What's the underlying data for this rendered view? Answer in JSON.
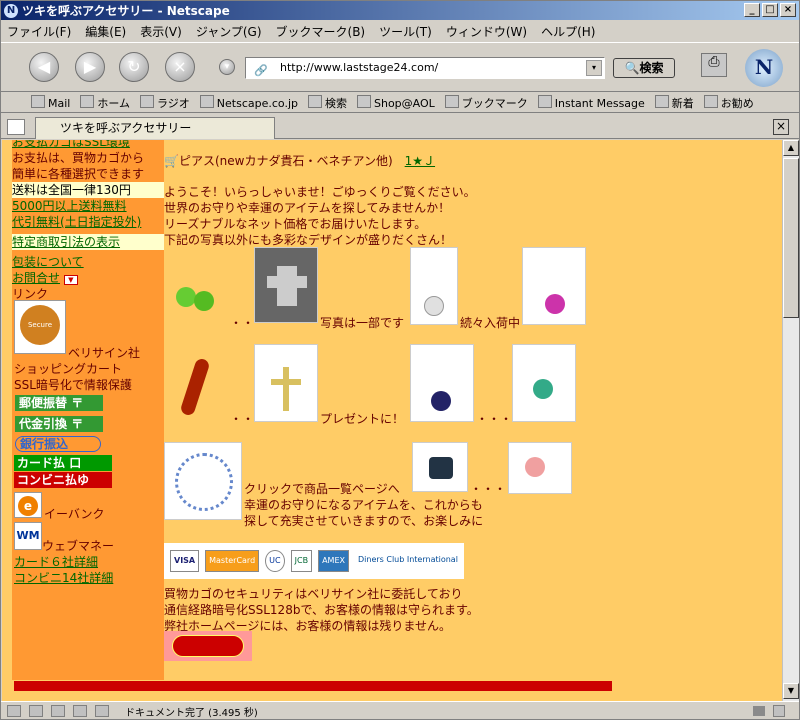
{
  "window": {
    "title": "ツキを呼ぶアクセサリー - Netscape"
  },
  "menu": [
    "ファイル(F)",
    "編集(E)",
    "表示(V)",
    "ジャンプ(G)",
    "ブックマーク(B)",
    "ツール(T)",
    "ウィンドウ(W)",
    "ヘルプ(H)"
  ],
  "nav": {
    "url": "http://www.laststage24.com/",
    "search_label": "検索"
  },
  "personal_bar": [
    "Mail",
    "ホーム",
    "ラジオ",
    "Netscape.co.jp",
    "検索",
    "Shop@AOL",
    "ブックマーク",
    "Instant Message",
    "新着",
    "お勧め"
  ],
  "tab": {
    "title": "ツキを呼ぶアクセサリー"
  },
  "sidebar": {
    "top_cut": "お支払カゴはSSL環境",
    "pay1": "お支払は、買物カゴから",
    "pay2": "簡単に各種選択できます",
    "shipping": "送料は全国一律130円",
    "free_ship": "5000円以上送料無料",
    "cod_free": "代引無料(土日指定投外)",
    "law": "特定商取引法の表示",
    "wrap": "包装について",
    "contact": "お問合せ",
    "links": "リンク",
    "verisign_text": "ベリサイン社",
    "cart1": "ショッピングカート",
    "cart2": "SSL暗号化で情報保護",
    "postal": "郵便振替",
    "cod": "代金引換",
    "bank": "銀行振込",
    "card": "カード払",
    "convenience": "コンビニ払",
    "ebank": "イーバンク",
    "webmoney": "ウェブマネー",
    "card_detail": "カード６社詳細",
    "conv_detail": "コンビニ14社詳細"
  },
  "main": {
    "top_cut": "ピアス(newカナダ貴石・ベネチアン他)",
    "top_link": "1★Ｊ",
    "welcome": "ようこそ！いらっしゃいませ！ごゆっくりご覧ください。",
    "line2": "世界のお守りや幸運のアイテムを探してみませんか！",
    "line3": "リーズナブルなネット価格でお届けいたします。",
    "line4": "下記の写真以外にも多彩なデザインが盛りだくさん！",
    "dots": "・・",
    "row1_text": "写真は一部です",
    "row1_text2": "続々入荷中",
    "row2_text": "プレゼントに！",
    "row2_dots": "・・・",
    "row3_text": "クリックで商品一覧ページへ",
    "row3_line2": "幸運のお守りになるアイテムを、これからも",
    "row3_line3": "探して充実させていきますので、お楽しみに",
    "security1": "買物カゴのセキュリティはベリサイン社に委託しており",
    "security2": "通信経路暗号化SSL128bで、お客様の情報は守られます。",
    "security3": "弊社ホームページには、お客様の情報は残りません。",
    "cards": [
      "VISA",
      "MasterCard",
      "UC",
      "JCB",
      "AMEX",
      "Diners Club International"
    ]
  },
  "status": {
    "text": "ドキュメント完了 (3.495 秒)"
  }
}
